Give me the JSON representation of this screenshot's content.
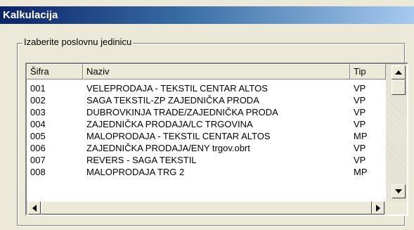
{
  "window": {
    "title": "Kalkulacija"
  },
  "group": {
    "legend": "Izaberite poslovnu jedinicu"
  },
  "list": {
    "columns": [
      "Šifra",
      "Naziv",
      "Tip"
    ],
    "rows": [
      {
        "code": "001",
        "name": "VELEPRODAJA - TEKSTIL CENTAR ALTOS",
        "tip": "VP"
      },
      {
        "code": "002",
        "name": "SAGA TEKSTIL-ZP  ZAJEDNIČKA PRODA",
        "tip": "VP"
      },
      {
        "code": "003",
        "name": "DUBROVKINJA TRADE/ZAJEDNIČKA PRODA",
        "tip": "VP"
      },
      {
        "code": "004",
        "name": "ZAJEDNIČKA PRODAJA/LC TRGOVINA",
        "tip": "VP"
      },
      {
        "code": "005",
        "name": "MALOPRODAJA - TEKSTIL CENTAR ALTOS",
        "tip": "MP"
      },
      {
        "code": "006",
        "name": "ZAJEDNIČKA PRODAJA/ENY trgov.obrt",
        "tip": "VP"
      },
      {
        "code": "007",
        "name": "REVERS - SAGA TEKSTIL",
        "tip": "VP"
      },
      {
        "code": "008",
        "name": "MALOPRODAJA TRG 2",
        "tip": "MP"
      }
    ]
  },
  "icons": {
    "scroll_up": "arrow-up-icon",
    "scroll_down": "arrow-down-icon",
    "scroll_left": "arrow-left-icon",
    "scroll_right": "arrow-right-icon"
  },
  "colors": {
    "titlebar_start": "#0a246a",
    "titlebar_end": "#a6caf0",
    "face": "#ece9d8"
  }
}
